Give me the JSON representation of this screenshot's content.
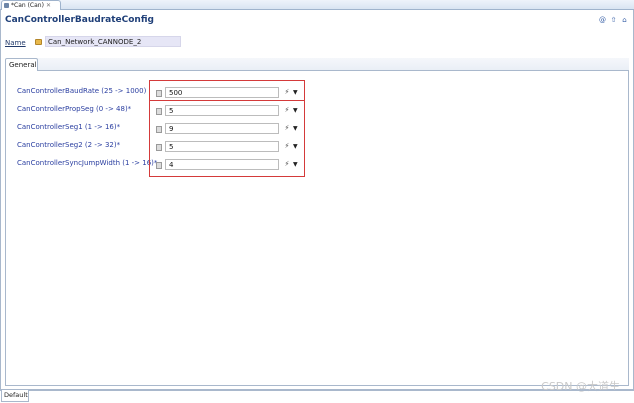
{
  "editor": {
    "tab_label": "*Can (Can)",
    "close_glyph": "✕",
    "title": "CanControllerBaudrateConfig"
  },
  "toolbar": {
    "icons": [
      "help-icon",
      "up-icon",
      "home-icon"
    ],
    "glyphs": [
      "@",
      "⇧",
      "⌂"
    ]
  },
  "name_row": {
    "label": "Name",
    "value": "Can_Network_CANNODE_2"
  },
  "section": {
    "tab_label": "General"
  },
  "params": [
    {
      "label": "CanControllerBaudRate (25 -> 1000)",
      "value": "500"
    },
    {
      "label": "CanControllerPropSeg (0 -> 48)*",
      "value": "5"
    },
    {
      "label": "CanControllerSeg1 (1 -> 16)*",
      "value": "9"
    },
    {
      "label": "CanControllerSeg2 (2 -> 32)*",
      "value": "5"
    },
    {
      "label": "CanControllerSyncJumpWidth (1 -> 16)*",
      "value": "4"
    }
  ],
  "icons": {
    "wand": "⚡",
    "menu": "▼"
  },
  "colors": {
    "title": "#1f3f78",
    "param_label": "#2a3ea0",
    "highlight": "#d43a3a",
    "name_field_bg": "#e6e6f6"
  },
  "footer": {
    "tab_label": "Default",
    "watermark": "CSDN @大道生"
  }
}
